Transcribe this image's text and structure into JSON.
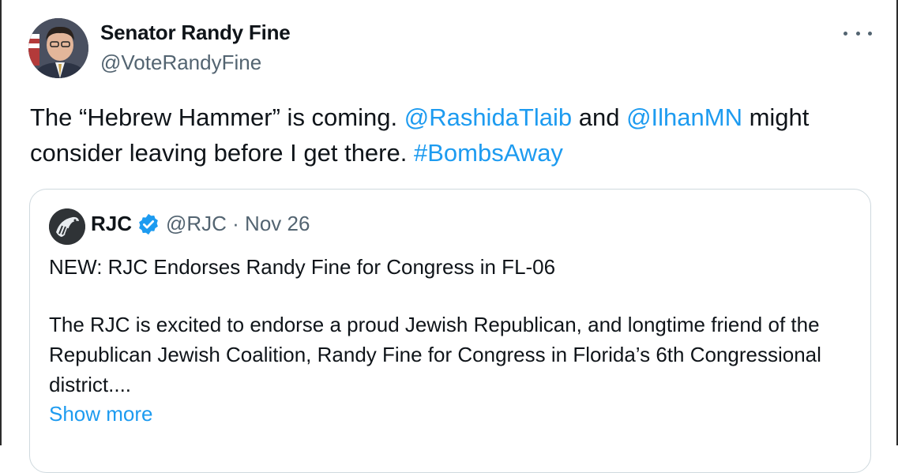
{
  "tweet": {
    "author": {
      "name": "Senator Randy Fine",
      "handle": "@VoteRandyFine"
    },
    "more_icon": "more-horizontal-icon",
    "text_parts": {
      "p1": "The “Hebrew Hammer” is coming.  ",
      "mention1": "@RashidaTlaib",
      "p2": " and ",
      "mention2": "@IlhanMN",
      "p3": " might consider leaving before I get there.  ",
      "hashtag": "#BombsAway"
    }
  },
  "quoted_tweet": {
    "author": {
      "name": "RJC",
      "verified_icon": "verified-badge-icon",
      "handle_date": "@RJC · Nov 26"
    },
    "headline": "NEW: RJC Endorses Randy Fine for Congress in FL-06",
    "body": "The RJC is excited to endorse a proud Jewish Republican, and longtime friend of the Republican Jewish Coalition, Randy Fine for Congress in Florida’s 6th Congressional district....",
    "show_more": "Show more"
  },
  "colors": {
    "link": "#1d9bf0",
    "text": "#0f1419",
    "muted": "#536471",
    "border": "#cfd9de"
  }
}
